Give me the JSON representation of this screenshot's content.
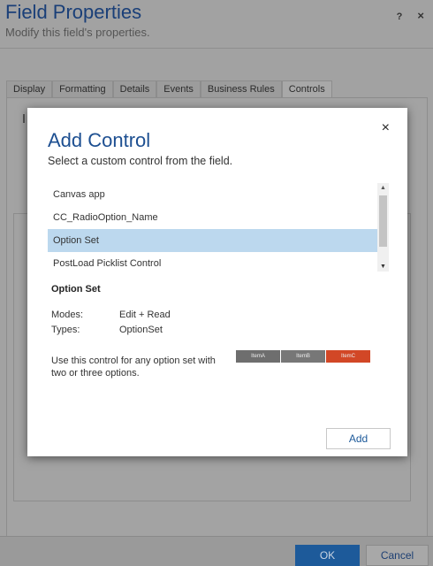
{
  "window": {
    "title": "Field Properties",
    "subtitle": "Modify this field's properties.",
    "help": "?",
    "close": "×"
  },
  "tabs": [
    {
      "label": "Display"
    },
    {
      "label": "Formatting"
    },
    {
      "label": "Details"
    },
    {
      "label": "Events"
    },
    {
      "label": "Business Rules"
    },
    {
      "label": "Controls",
      "active": true
    }
  ],
  "footer": {
    "ok_label": "OK",
    "cancel_label": "Cancel"
  },
  "modal": {
    "title": "Add Control",
    "subtitle": "Select a custom control from the field.",
    "close": "×",
    "list_items": [
      {
        "label": "Canvas app"
      },
      {
        "label": "CC_RadioOption_Name"
      },
      {
        "label": "Option Set",
        "selected": true
      },
      {
        "label": "PostLoad Picklist Control"
      }
    ],
    "scroll_up": "▲",
    "scroll_down": "▼",
    "detail": {
      "title": "Option Set",
      "modes_label": "Modes:",
      "modes_value": "Edit + Read",
      "types_label": "Types:",
      "types_value": "OptionSet",
      "description": "Use this control for any option set with two or three options."
    },
    "preview_items": [
      "ItemA",
      "ItemB",
      "ItemC"
    ],
    "add_label": "Add"
  }
}
